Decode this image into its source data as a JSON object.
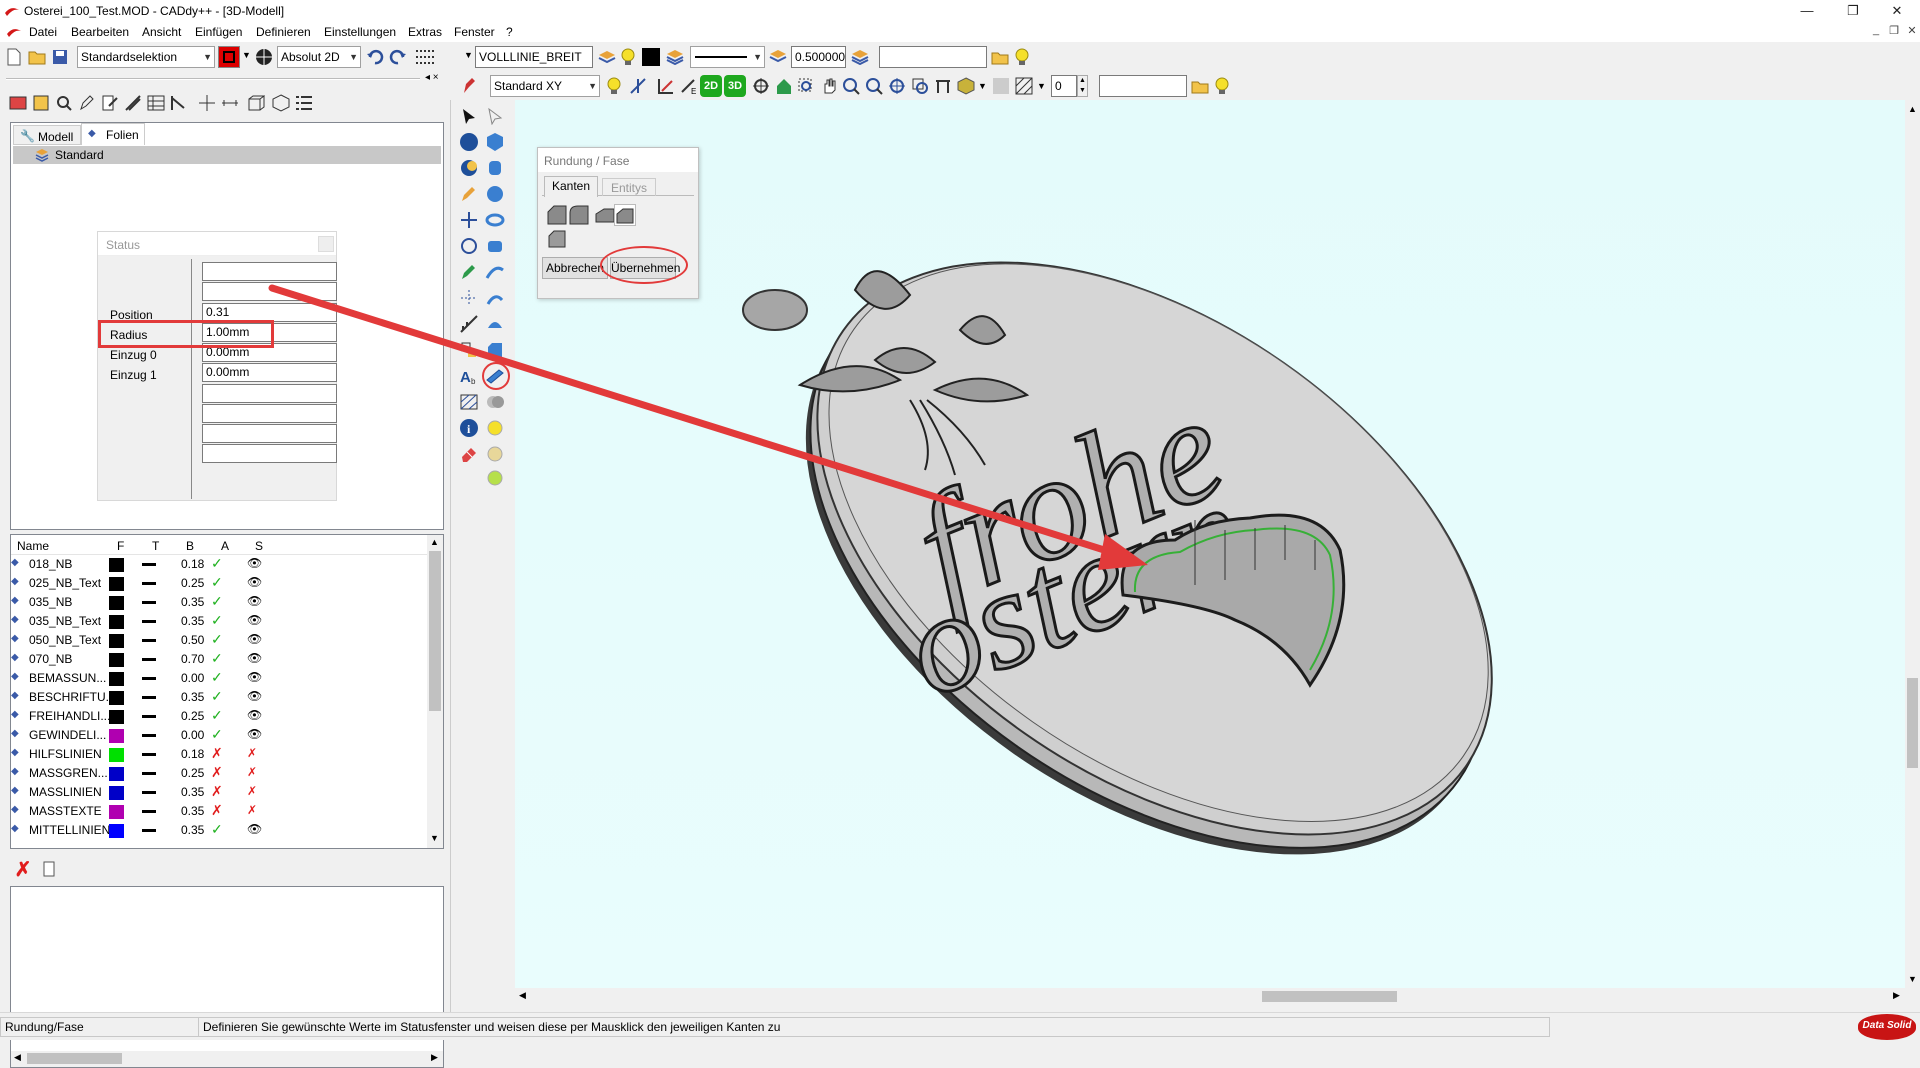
{
  "window": {
    "title": "Osterei_100_Test.MOD  -  CADdy++ - [3D-Modell]",
    "controls": [
      "—",
      "❐",
      "✕"
    ]
  },
  "menu": [
    "Datei",
    "Bearbeiten",
    "Ansicht",
    "Einfügen",
    "Definieren",
    "Einstellungen",
    "Extras",
    "Fenster",
    "?"
  ],
  "toolbar1": {
    "selection": "Standardselektion",
    "coord_mode": "Absolut 2D",
    "linetype": "VOLLLINIE_BREIT",
    "linewidth": "0.500000",
    "search": ""
  },
  "toolbar2": {
    "view": "Standard XY",
    "count": "0",
    "search": "",
    "btn_2d": "2D",
    "btn_3d": "3D"
  },
  "tabs": {
    "model": "Modell",
    "layers": "Folien"
  },
  "tree": {
    "root": "Standard"
  },
  "status_window": {
    "title": "Status",
    "rows": [
      {
        "label": "Position",
        "value": "0.31"
      },
      {
        "label": "Radius",
        "value": "1.00mm"
      },
      {
        "label": "Einzug 0",
        "value": "0.00mm"
      },
      {
        "label": "Einzug 1",
        "value": "0.00mm"
      }
    ]
  },
  "layer_table": {
    "headers": [
      "Name",
      "F",
      "T",
      "B",
      "A",
      "S"
    ],
    "rows": [
      {
        "name": "018_NB",
        "color": "#000000",
        "width": "0.18",
        "active": "✓",
        "visible": "👁"
      },
      {
        "name": "025_NB_Text",
        "color": "#000000",
        "width": "0.25",
        "active": "✓",
        "visible": "👁"
      },
      {
        "name": "035_NB",
        "color": "#000000",
        "width": "0.35",
        "active": "✓",
        "visible": "👁"
      },
      {
        "name": "035_NB_Text",
        "color": "#000000",
        "width": "0.35",
        "active": "✓",
        "visible": "👁"
      },
      {
        "name": "050_NB_Text",
        "color": "#000000",
        "width": "0.50",
        "active": "✓",
        "visible": "👁"
      },
      {
        "name": "070_NB",
        "color": "#000000",
        "width": "0.70",
        "active": "✓",
        "visible": "👁"
      },
      {
        "name": "BEMASSUN...",
        "color": "#000000",
        "width": "0.00",
        "active": "✓",
        "visible": "👁"
      },
      {
        "name": "BESCHRIFTU...",
        "color": "#000000",
        "width": "0.35",
        "active": "✓",
        "visible": "👁"
      },
      {
        "name": "FREIHANDLI...",
        "color": "#000000",
        "width": "0.25",
        "active": "✓",
        "visible": "👁"
      },
      {
        "name": "GEWINDELI...",
        "color": "#b000b0",
        "width": "0.00",
        "active": "✓",
        "visible": "👁"
      },
      {
        "name": "HILFSLINIEN",
        "color": "#00e000",
        "width": "0.18",
        "active": "✗",
        "visible": "✗"
      },
      {
        "name": "MASSGREN...",
        "color": "#0000c8",
        "width": "0.25",
        "active": "✗",
        "visible": "✗"
      },
      {
        "name": "MASSLINIEN",
        "color": "#0000c8",
        "width": "0.35",
        "active": "✗",
        "visible": "✗"
      },
      {
        "name": "MASSTEXTE",
        "color": "#b000b0",
        "width": "0.35",
        "active": "✗",
        "visible": "✗"
      },
      {
        "name": "MITTELLINIEN",
        "color": "#0000ff",
        "width": "0.35",
        "active": "✓",
        "visible": "👁"
      }
    ]
  },
  "dialog": {
    "title": "Rundung / Fase",
    "tab_edges": "Kanten",
    "tab_entities": "Entitys",
    "cancel": "Abbrechen",
    "apply": "Übernehmen"
  },
  "model_text": {
    "line1": "frohe",
    "line2": "ostern"
  },
  "statusbar": {
    "mode": "Rundung/Fase",
    "hint": "Definieren Sie gewünschte Werte im Statusfenster und weisen diese per Mausklick den jeweiligen Kanten zu",
    "logo": "Data Solid"
  },
  "colors": {
    "accent_red": "#e23a3a",
    "viewport_bg": "#e6fcfc"
  }
}
